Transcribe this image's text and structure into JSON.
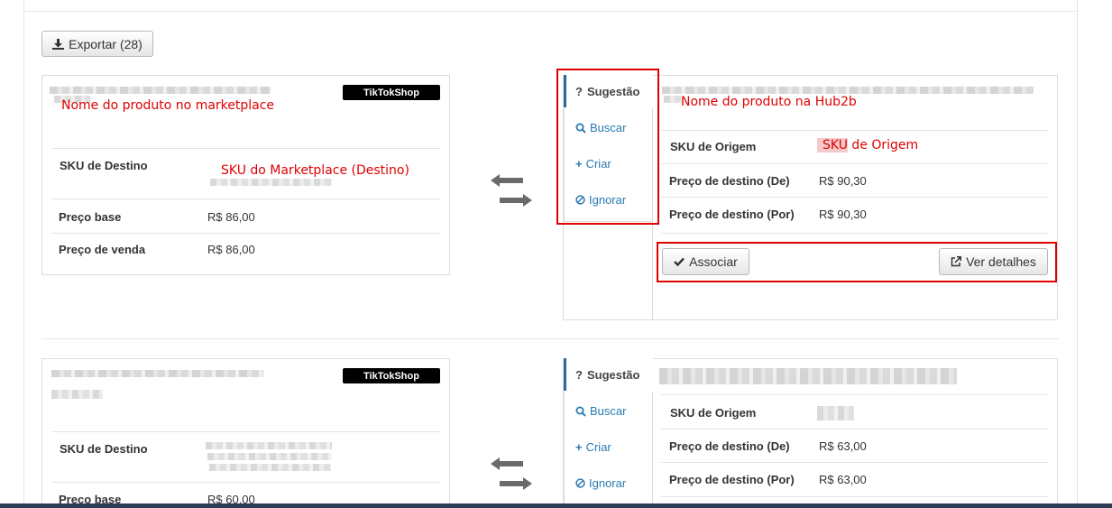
{
  "toolbar": {
    "export_label": "Exportar (28)",
    "export_icon": "download-icon"
  },
  "rows": [
    {
      "marketplace": {
        "badge": "TikTokShop",
        "name_note": "Nome do produto no marketplace",
        "fields": [
          {
            "label": "SKU de Destino",
            "value_note": "SKU do Marketplace (Destino)"
          },
          {
            "label": "Preço base",
            "value": "R$ 86,00"
          },
          {
            "label": "Preço de venda",
            "value": "R$ 86,00"
          }
        ]
      },
      "hub": {
        "tabs": {
          "suggestion": "Sugestão",
          "search": "Buscar",
          "create": "Criar",
          "ignore": "Ignorar"
        },
        "name_note": "Nome do produto na Hub2b",
        "fields": [
          {
            "label": "SKU de Origem",
            "value_note_hl": "SKU",
            "value_note_rest": " de Origem"
          },
          {
            "label": "Preço de destino (De)",
            "value": "R$ 90,30"
          },
          {
            "label": "Preço de destino (Por)",
            "value": "R$ 90,30"
          }
        ],
        "associate_label": "Associar",
        "details_label": "Ver detalhes"
      }
    },
    {
      "marketplace": {
        "badge": "TikTokShop",
        "fields": [
          {
            "label": "SKU de Destino"
          },
          {
            "label": "Preço base",
            "value": "R$ 60,00"
          }
        ]
      },
      "hub": {
        "tabs": {
          "suggestion": "Sugestão",
          "search": "Buscar",
          "create": "Criar",
          "ignore": "Ignorar"
        },
        "fields": [
          {
            "label": "SKU de Origem"
          },
          {
            "label": "Preço de destino (De)",
            "value": "R$ 63,00"
          },
          {
            "label": "Preço de destino (Por)",
            "value": "R$ 63,00"
          }
        ]
      }
    }
  ],
  "colors": {
    "annotation": "#e00000",
    "link": "#2a7ab0",
    "badge_bg": "#000000",
    "active_tab_border": "#2a6aa0"
  }
}
